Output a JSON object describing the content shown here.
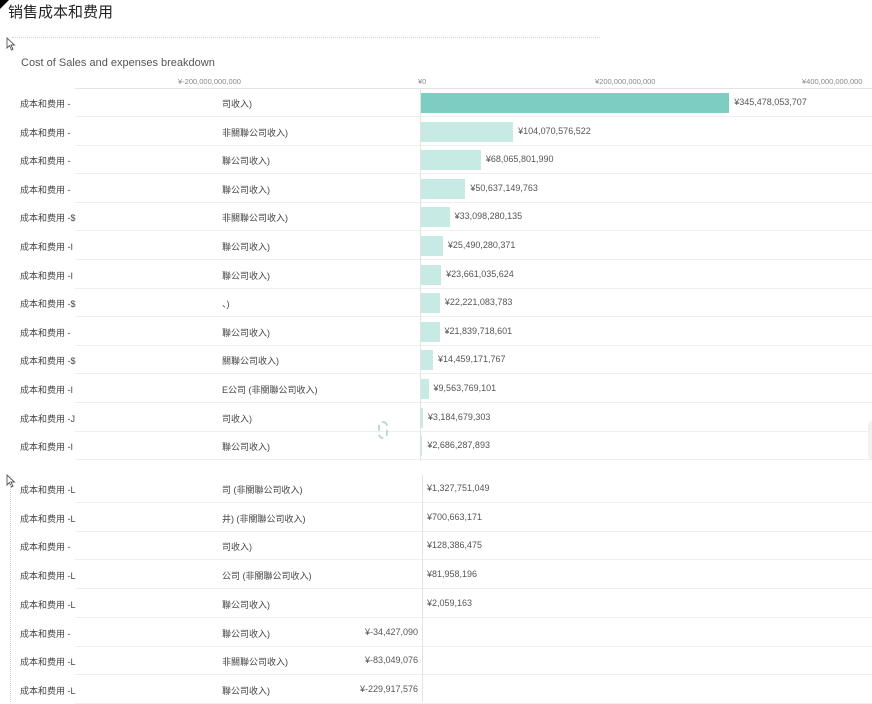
{
  "page": {
    "title": "销售成本和费用"
  },
  "chart_data": {
    "type": "bar",
    "orientation": "horizontal",
    "title": "Cost of Sales and expenses breakdown",
    "xlim": [
      -200000000000,
      400000000000
    ],
    "x_ticks": [
      {
        "value": -200000000000,
        "label": "¥-200,000,000,000"
      },
      {
        "value": 0,
        "label": "¥0"
      },
      {
        "value": 200000000000,
        "label": "¥200,000,000,000"
      },
      {
        "value": 400000000000,
        "label": "¥400,000,000,000"
      }
    ],
    "highlight_color": "#7ecdc2",
    "bar_color": "#c8eae5",
    "series": [
      {
        "values": [
          345478053707,
          104070576522,
          68065801990,
          50637149763,
          33098280135,
          25490280371,
          23661035624,
          22221083783,
          21839718601,
          14459171767,
          9563769101,
          3184679303,
          2686287893,
          1327751049,
          700663171,
          128386475,
          81958196,
          2059163,
          -34427090,
          -83049076,
          -229917576
        ]
      }
    ],
    "categories": [
      {
        "prefix": "成本和费用 -",
        "suffix": "司收入)",
        "value_label": "¥345,478,053,707"
      },
      {
        "prefix": "成本和费用 -",
        "suffix": "非關聯公司收入)",
        "value_label": "¥104,070,576,522"
      },
      {
        "prefix": "成本和费用 -",
        "suffix": "聯公司收入)",
        "value_label": "¥68,065,801,990"
      },
      {
        "prefix": "成本和费用 -",
        "suffix": "聯公司收入)",
        "value_label": "¥50,637,149,763"
      },
      {
        "prefix": "成本和费用 -$",
        "suffix": "非關聯公司收入)",
        "value_label": "¥33,098,280,135"
      },
      {
        "prefix": "成本和费用 -I",
        "suffix": "聯公司收入)",
        "value_label": "¥25,490,280,371"
      },
      {
        "prefix": "成本和费用 -I",
        "suffix": "聯公司收入)",
        "value_label": "¥23,661,035,624"
      },
      {
        "prefix": "成本和费用 -$",
        "suffix": "、)",
        "value_label": "¥22,221,083,783"
      },
      {
        "prefix": "成本和费用 -",
        "suffix": "聯公司收入)",
        "value_label": "¥21,839,718,601"
      },
      {
        "prefix": "成本和费用 -$",
        "suffix": "關聯公司收入)",
        "value_label": "¥14,459,171,767"
      },
      {
        "prefix": "成本和费用 -I",
        "suffix": "E公司 (非關聯公司收入)",
        "value_label": "¥9,563,769,101"
      },
      {
        "prefix": "成本和费用 -J",
        "suffix": "司收入)",
        "value_label": "¥3,184,679,303"
      },
      {
        "prefix": "成本和费用 -I",
        "suffix": "聯公司收入)",
        "value_label": "¥2,686,287,893"
      },
      {
        "prefix": "成本和费用 -L",
        "suffix": "司 (非關聯公司收入)",
        "value_label": "¥1,327,751,049"
      },
      {
        "prefix": "成本和费用 -L",
        "suffix": "井) (非關聯公司收入)",
        "value_label": "¥700,663,171"
      },
      {
        "prefix": "成本和费用 -",
        "suffix": "司收入)",
        "value_label": "¥128,386,475"
      },
      {
        "prefix": "成本和费用 -L",
        "suffix": "公司 (非關聯公司收入)",
        "value_label": "¥81,958,196"
      },
      {
        "prefix": "成本和费用 -L",
        "suffix": "聯公司收入)",
        "value_label": "¥2,059,163"
      },
      {
        "prefix": "成本和费用 -",
        "suffix": "聯公司收入)",
        "value_label": "¥-34,427,090"
      },
      {
        "prefix": "成本和费用 -L",
        "suffix": "非關聯公司收入)",
        "value_label": "¥-83,049,076"
      },
      {
        "prefix": "成本和费用 -L",
        "suffix": "聯公司收入)",
        "value_label": "¥-229,917,576"
      }
    ]
  }
}
